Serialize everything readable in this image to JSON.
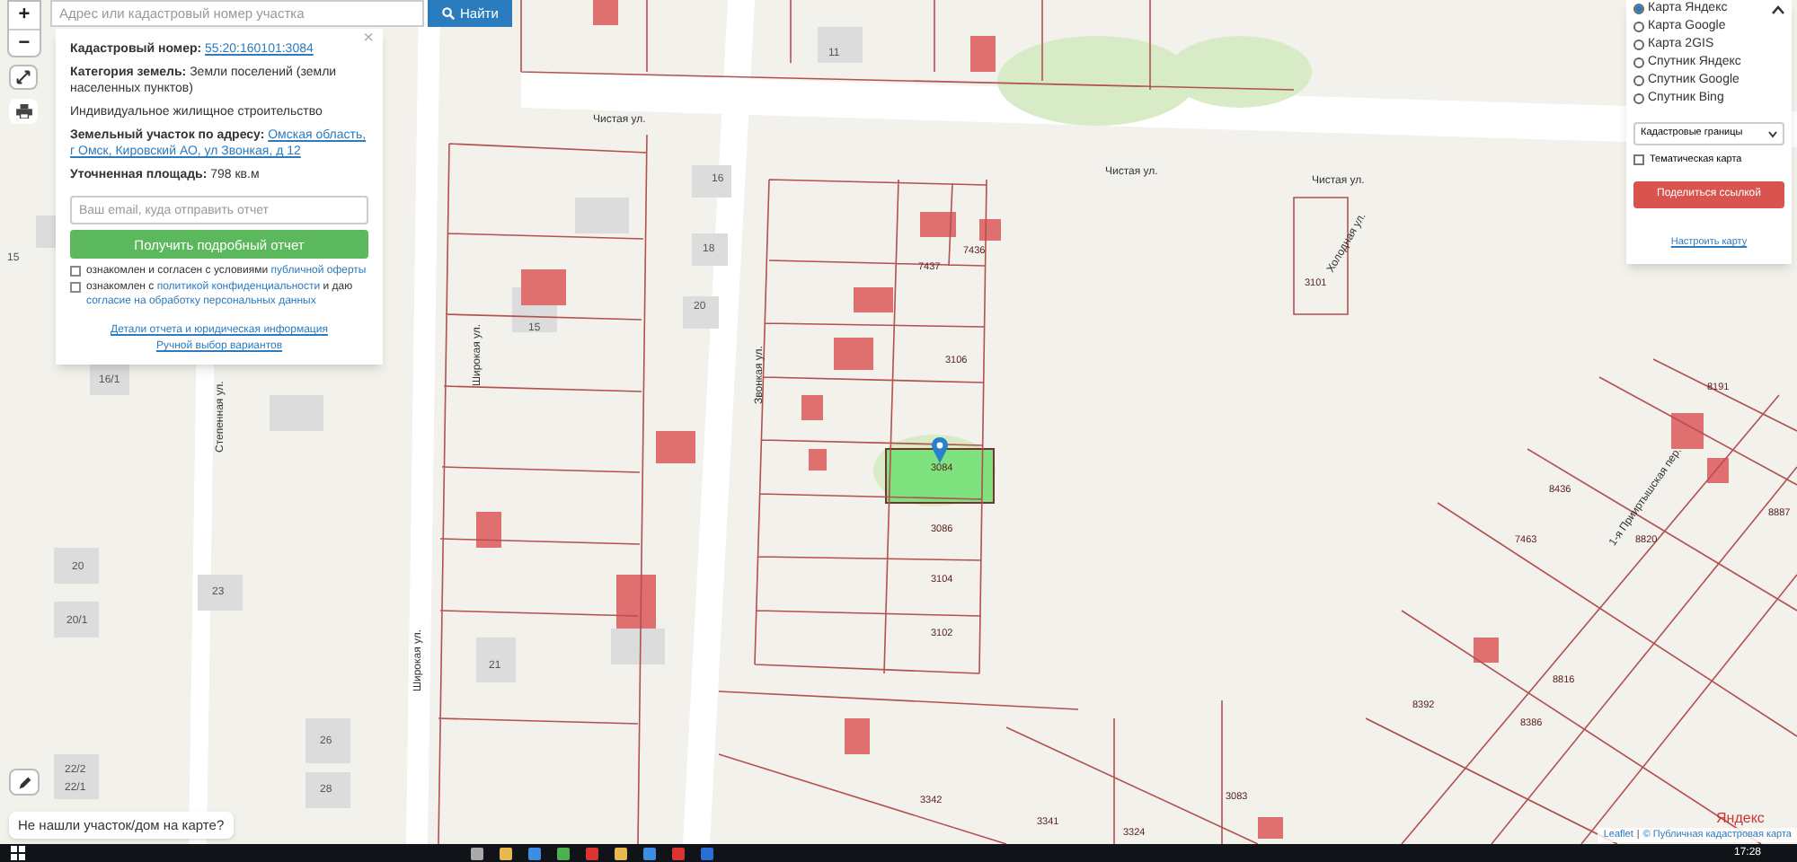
{
  "search": {
    "placeholder": "Адрес или кадастровый номер участка",
    "button": "Найти"
  },
  "zoom_controls": [
    "+",
    "−"
  ],
  "popup": {
    "close": "×",
    "cadastral_label": "Кадастровый номер:",
    "cadastral_number": "55:20:160101:3084",
    "category_label": "Категория земель:",
    "category_value": "Земли поселений (земли населенных пунктов)",
    "use": "Индивидуальное жилищное строительство",
    "address_label": "Земельный участок по адресу:",
    "address": "Омская область, г Омск, Кировский АО, ул Звонкая, д 12",
    "area_label": "Уточненная площадь:",
    "area_value": "798 кв.м",
    "email_placeholder": "Ваш email, куда отправить отчет",
    "report_button": "Получить подробный отчет",
    "consents": [
      {
        "checked": false,
        "parts": [
          {
            "text": "ознакомлен и согласен с условиями",
            "link": false
          },
          {
            "text": "публичной оферты",
            "link": true
          }
        ]
      },
      {
        "checked": false,
        "parts": [
          {
            "text": "ознакомлен с",
            "link": false
          },
          {
            "text": "политикой конфиденциальности",
            "link": true
          },
          {
            "text": "и даю",
            "link": false
          },
          {
            "text": "согласие на обработку персональных данных",
            "link": true
          }
        ]
      }
    ],
    "links": [
      "Детали отчета и юридическая информация",
      "Ручной выбор вариантов"
    ]
  },
  "layers": {
    "base_maps": [
      {
        "label": "Карта Яндекс",
        "selected": true
      },
      {
        "label": "Карта Google",
        "selected": false
      },
      {
        "label": "Карта 2GIS",
        "selected": false
      },
      {
        "label": "Спутник Яндекс",
        "selected": false
      },
      {
        "label": "Спутник Google",
        "selected": false
      },
      {
        "label": "Спутник Bing",
        "selected": false
      }
    ],
    "overlay_select": "Кадастровые границы",
    "thematic": {
      "label": "Тематическая карта",
      "checked": false
    },
    "share_button": "Поделиться ссылкой",
    "settings_link": "Настроить карту"
  },
  "map_labels": [
    {
      "text": "Чистая ул.",
      "kind": "street"
    },
    {
      "text": "Чистая ул.",
      "kind": "street"
    },
    {
      "text": "Чистая ул.",
      "kind": "street"
    },
    {
      "text": "Широкая ул.",
      "kind": "vstreet"
    },
    {
      "text": "Широкая ул.",
      "kind": "vstreet"
    },
    {
      "text": "Звонкая ул.",
      "kind": "vstreet"
    },
    {
      "text": "Степенная ул.",
      "kind": "vstreet"
    },
    {
      "text": "Холодная ул.",
      "kind": "vstreet"
    },
    {
      "text": "1-я Прииртышская пер.",
      "kind": "vstreet"
    },
    {
      "text": "7437",
      "kind": "parcel"
    },
    {
      "text": "7436",
      "kind": "parcel"
    },
    {
      "text": "3106",
      "kind": "parcel"
    },
    {
      "text": "3084",
      "kind": "parcel"
    },
    {
      "text": "3086",
      "kind": "parcel"
    },
    {
      "text": "3104",
      "kind": "parcel"
    },
    {
      "text": "3102",
      "kind": "parcel"
    },
    {
      "text": "3101",
      "kind": "parcel"
    },
    {
      "text": "3342",
      "kind": "parcel"
    },
    {
      "text": "3341",
      "kind": "parcel"
    },
    {
      "text": "3083",
      "kind": "parcel"
    },
    {
      "text": "3324",
      "kind": "parcel"
    },
    {
      "text": "7463",
      "kind": "parcel"
    },
    {
      "text": "8392",
      "kind": "parcel"
    },
    {
      "text": "8436",
      "kind": "parcel"
    },
    {
      "text": "8820",
      "kind": "parcel"
    },
    {
      "text": "8386",
      "kind": "parcel"
    },
    {
      "text": "8816",
      "kind": "parcel"
    },
    {
      "text": "8191",
      "kind": "parcel"
    },
    {
      "text": "8887",
      "kind": "parcel"
    },
    {
      "text": "15",
      "kind": "house"
    },
    {
      "text": "15",
      "kind": "house"
    },
    {
      "text": "16",
      "kind": "house"
    },
    {
      "text": "18",
      "kind": "house"
    },
    {
      "text": "20",
      "kind": "house"
    },
    {
      "text": "21",
      "kind": "house"
    },
    {
      "text": "23",
      "kind": "house"
    },
    {
      "text": "20",
      "kind": "house"
    },
    {
      "text": "20/1",
      "kind": "house"
    },
    {
      "text": "16/1",
      "kind": "house"
    },
    {
      "text": "26",
      "kind": "house"
    },
    {
      "text": "28",
      "kind": "house"
    },
    {
      "text": "22/2",
      "kind": "house"
    },
    {
      "text": "22/1",
      "kind": "house"
    },
    {
      "text": "11",
      "kind": "house"
    }
  ],
  "not_found_button": "Не нашли участок/дом на карте?",
  "provider_logo": "Яндекс",
  "attribution": [
    {
      "text": "Leaflet",
      "link": true
    },
    {
      "text": "|",
      "link": false
    },
    {
      "text": "© Публичная кадастровая карта",
      "link": true
    }
  ],
  "taskbar": {
    "time": "17:28"
  }
}
